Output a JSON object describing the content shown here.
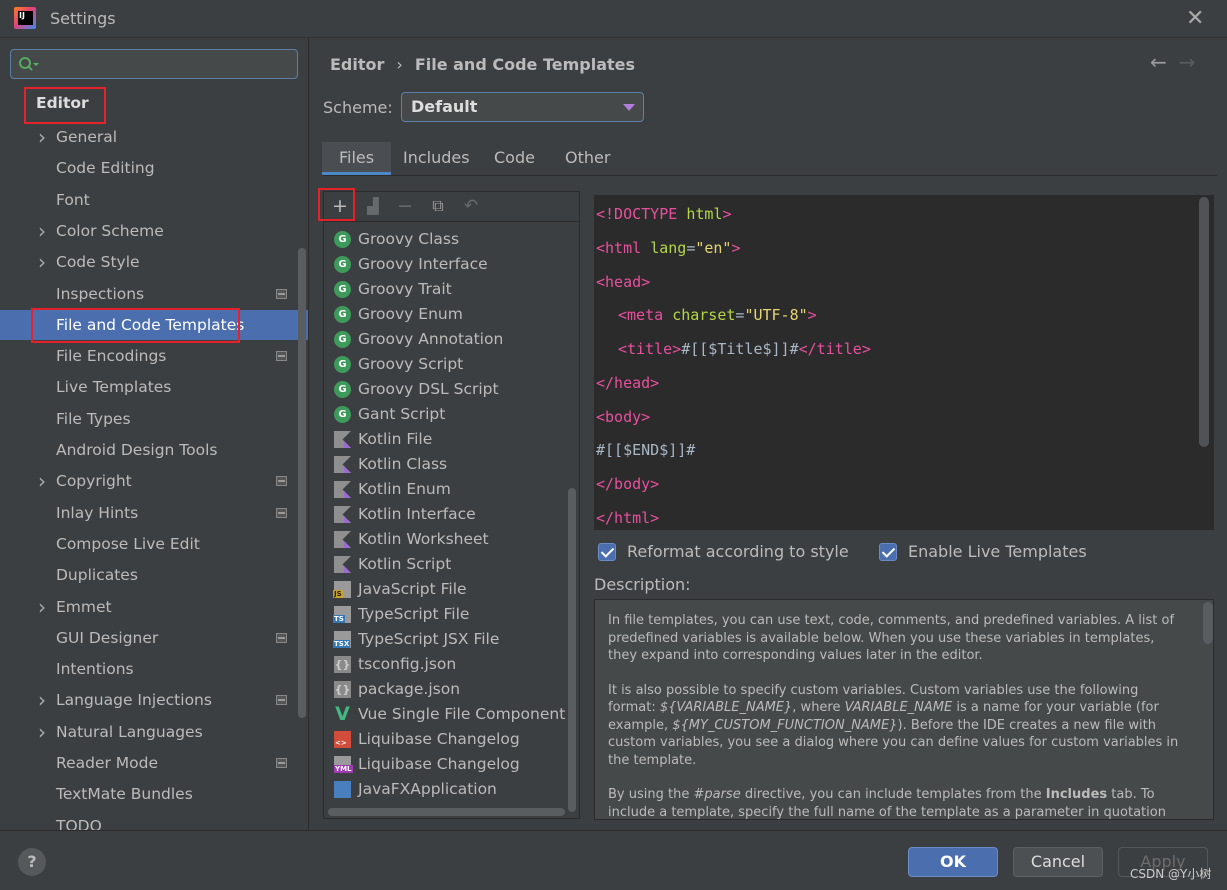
{
  "window": {
    "title": "Settings"
  },
  "sidebar": {
    "search_placeholder": "",
    "root": "Editor",
    "items": [
      {
        "label": "General",
        "expandable": true,
        "badge": false
      },
      {
        "label": "Code Editing",
        "expandable": false,
        "badge": false
      },
      {
        "label": "Font",
        "expandable": false,
        "badge": false
      },
      {
        "label": "Color Scheme",
        "expandable": true,
        "badge": false
      },
      {
        "label": "Code Style",
        "expandable": true,
        "badge": false
      },
      {
        "label": "Inspections",
        "expandable": false,
        "badge": true
      },
      {
        "label": "File and Code Templates",
        "expandable": false,
        "badge": false,
        "selected": true
      },
      {
        "label": "File Encodings",
        "expandable": false,
        "badge": true
      },
      {
        "label": "Live Templates",
        "expandable": false,
        "badge": false
      },
      {
        "label": "File Types",
        "expandable": false,
        "badge": false
      },
      {
        "label": "Android Design Tools",
        "expandable": false,
        "badge": false
      },
      {
        "label": "Copyright",
        "expandable": true,
        "badge": true
      },
      {
        "label": "Inlay Hints",
        "expandable": false,
        "badge": true
      },
      {
        "label": "Compose Live Edit",
        "expandable": false,
        "badge": false
      },
      {
        "label": "Duplicates",
        "expandable": false,
        "badge": false
      },
      {
        "label": "Emmet",
        "expandable": true,
        "badge": false
      },
      {
        "label": "GUI Designer",
        "expandable": false,
        "badge": true
      },
      {
        "label": "Intentions",
        "expandable": false,
        "badge": false
      },
      {
        "label": "Language Injections",
        "expandable": true,
        "badge": true
      },
      {
        "label": "Natural Languages",
        "expandable": true,
        "badge": false
      },
      {
        "label": "Reader Mode",
        "expandable": false,
        "badge": true
      },
      {
        "label": "TextMate Bundles",
        "expandable": false,
        "badge": false
      },
      {
        "label": "TODO",
        "expandable": false,
        "badge": false
      }
    ]
  },
  "breadcrumb": {
    "parent": "Editor",
    "separator": "›",
    "current": "File and Code Templates"
  },
  "nav": {
    "back": "←",
    "forward": "→"
  },
  "scheme": {
    "label": "Scheme:",
    "value": "Default"
  },
  "tabs": [
    "Files",
    "Includes",
    "Code",
    "Other"
  ],
  "toolbar": {
    "add": "+",
    "remove": "−"
  },
  "templates": [
    {
      "label": "Groovy Class",
      "icon": "groovy"
    },
    {
      "label": "Groovy Interface",
      "icon": "groovy"
    },
    {
      "label": "Groovy Trait",
      "icon": "groovy"
    },
    {
      "label": "Groovy Enum",
      "icon": "groovy"
    },
    {
      "label": "Groovy Annotation",
      "icon": "groovy"
    },
    {
      "label": "Groovy Script",
      "icon": "groovy"
    },
    {
      "label": "Groovy DSL Script",
      "icon": "groovy"
    },
    {
      "label": "Gant Script",
      "icon": "groovy"
    },
    {
      "label": "Kotlin File",
      "icon": "kotlin"
    },
    {
      "label": "Kotlin Class",
      "icon": "kotlin"
    },
    {
      "label": "Kotlin Enum",
      "icon": "kotlin"
    },
    {
      "label": "Kotlin Interface",
      "icon": "kotlin"
    },
    {
      "label": "Kotlin Worksheet",
      "icon": "kotlin"
    },
    {
      "label": "Kotlin Script",
      "icon": "kotlin"
    },
    {
      "label": "JavaScript File",
      "icon": "js"
    },
    {
      "label": "TypeScript File",
      "icon": "ts"
    },
    {
      "label": "TypeScript JSX File",
      "icon": "tsx"
    },
    {
      "label": "tsconfig.json",
      "icon": "json"
    },
    {
      "label": "package.json",
      "icon": "json"
    },
    {
      "label": "Vue Single File Component",
      "icon": "vue"
    },
    {
      "label": "Liquibase Changelog",
      "icon": "liquibase-xml"
    },
    {
      "label": "Liquibase Changelog",
      "icon": "liquibase-yml"
    },
    {
      "label": "JavaFXApplication",
      "icon": "javafx"
    }
  ],
  "icon_text": {
    "groovy": "G",
    "js": "JS",
    "ts": "TS",
    "tsx": "TSX",
    "json": "{}",
    "vue": "V",
    "liquibase-xml": "<>",
    "liquibase-yml": "YML"
  },
  "editor": {
    "l1": {
      "a": "<!DOCTYPE ",
      "b": "html",
      "c": ">"
    },
    "l2": {
      "a": "<html ",
      "b": "lang",
      "c": "=",
      "d": "\"en\"",
      "e": ">"
    },
    "l3": "<head>",
    "l4": {
      "a": "<meta ",
      "b": "charset",
      "c": "=",
      "d": "\"UTF-8\"",
      "e": ">"
    },
    "l5": {
      "a": "<title>",
      "b": "#[[$Title$]]#",
      "c": "</title>"
    },
    "l6": "</head>",
    "l7": "<body>",
    "l8": "#[[$END$]]#",
    "l9": "</body>",
    "l10": "</html>"
  },
  "options": {
    "reformat": "Reformat according to style",
    "live_templates": "Enable Live Templates"
  },
  "description": {
    "label": "Description:",
    "p1": "In file templates, you can use text, code, comments, and predefined variables. A list of predefined variables is available below. When you use these variables in templates, they expand into corresponding values later in the editor.",
    "p2a": "It is also possible to specify custom variables. Custom variables use the following format: ",
    "p2b": "${VARIABLE_NAME}",
    "p2c": ", where ",
    "p2d": "VARIABLE_NAME",
    "p2e": " is a name for your variable (for example, ",
    "p2f": "${MY_CUSTOM_FUNCTION_NAME}",
    "p2g": "). Before the IDE creates a new file with custom variables, you see a dialog where you can define values for custom variables in the template.",
    "p3a": "By using the ",
    "p3b": "#parse",
    "p3c": " directive, you can include templates from the ",
    "p3d": "Includes",
    "p3e": " tab. To include a template, specify the full name of the template as a parameter in quotation marks (for"
  },
  "footer": {
    "help": "?",
    "ok": "OK",
    "cancel": "Cancel",
    "apply": "Apply",
    "watermark": "CSDN @Y小树"
  }
}
